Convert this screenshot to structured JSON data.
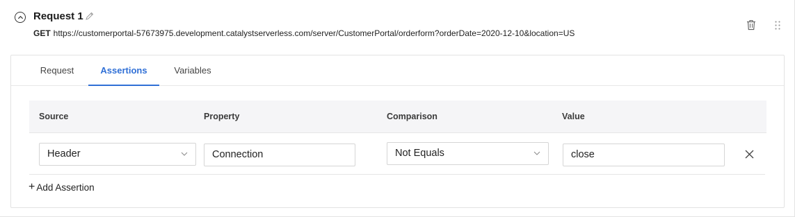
{
  "request": {
    "title": "Request 1",
    "method": "GET",
    "url": "https://customerportal-57673975.development.catalystserverless.com/server/CustomerPortal/orderform?orderDate=2020-12-10&location=US"
  },
  "tabs": [
    {
      "label": "Request",
      "active": false
    },
    {
      "label": "Assertions",
      "active": true
    },
    {
      "label": "Variables",
      "active": false
    }
  ],
  "table": {
    "headers": {
      "source": "Source",
      "property": "Property",
      "comparison": "Comparison",
      "value": "Value"
    },
    "rows": [
      {
        "source": "Header",
        "property": "Connection",
        "comparison": "Not Equals",
        "value": "close"
      }
    ]
  },
  "add_assertion_label": "Add Assertion",
  "icons": {
    "collapse": "chevron-up-circle-icon",
    "edit": "pencil-icon",
    "delete": "trash-icon",
    "drag": "drag-handle-icon",
    "remove": "close-icon",
    "dropdown": "chevron-down-icon",
    "add": "plus-icon"
  },
  "colors": {
    "accent": "#2f6fd6",
    "header_bg": "#f5f5f7"
  }
}
